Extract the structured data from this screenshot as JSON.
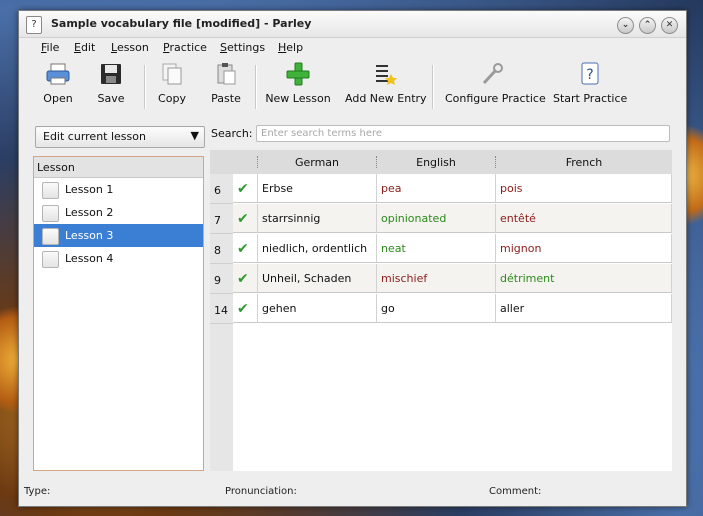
{
  "window": {
    "title": "Sample vocabulary file [modified] - Parley",
    "app_icon": "?",
    "buttons": {
      "minimize": "⌄",
      "maximize": "⌃",
      "close": "✕"
    }
  },
  "menu": {
    "items": [
      {
        "first": "F",
        "rest": "ile"
      },
      {
        "first": "E",
        "rest": "dit"
      },
      {
        "first": "L",
        "rest": "esson"
      },
      {
        "first": "P",
        "rest": "ractice"
      },
      {
        "first": "S",
        "rest": "ettings"
      },
      {
        "first": "H",
        "rest": "elp"
      }
    ]
  },
  "toolbar": {
    "open": "Open",
    "save": "Save",
    "copy": "Copy",
    "paste": "Paste",
    "new_lesson": "New Lesson",
    "add_new_entry": "Add New Entry",
    "configure_practice": "Configure Practice",
    "start_practice": "Start Practice"
  },
  "lessons": {
    "mode": "Edit current lesson",
    "header": "Lesson",
    "items": [
      "Lesson 1",
      "Lesson 2",
      "Lesson 3",
      "Lesson 4"
    ],
    "selected_index": 2
  },
  "search": {
    "label": "Search:",
    "placeholder": "Enter search terms here",
    "value": ""
  },
  "table": {
    "columns": [
      "German",
      "English",
      "French"
    ],
    "rows": [
      {
        "num": "6",
        "german": "Erbse",
        "english": "pea",
        "french": "pois"
      },
      {
        "num": "7",
        "german": "starrsinnig",
        "english": "opinionated",
        "french": "entêté"
      },
      {
        "num": "8",
        "german": "niedlich, ordentlich",
        "english": "neat",
        "french": "mignon"
      },
      {
        "num": "9",
        "german": "Unheil, Schaden",
        "english": "mischief",
        "french": "détriment"
      },
      {
        "num": "14",
        "german": "gehen",
        "english": "go",
        "french": "aller"
      }
    ],
    "check_glyph": "✔"
  },
  "status": {
    "type": "Type:",
    "pronunciation": "Pronunciation:",
    "comment": "Comment:"
  },
  "colors": {
    "selection": "#3b7fd4",
    "check": "#2e9a2e",
    "word_red": "#8a1c1c",
    "word_green": "#2b8a1c"
  }
}
